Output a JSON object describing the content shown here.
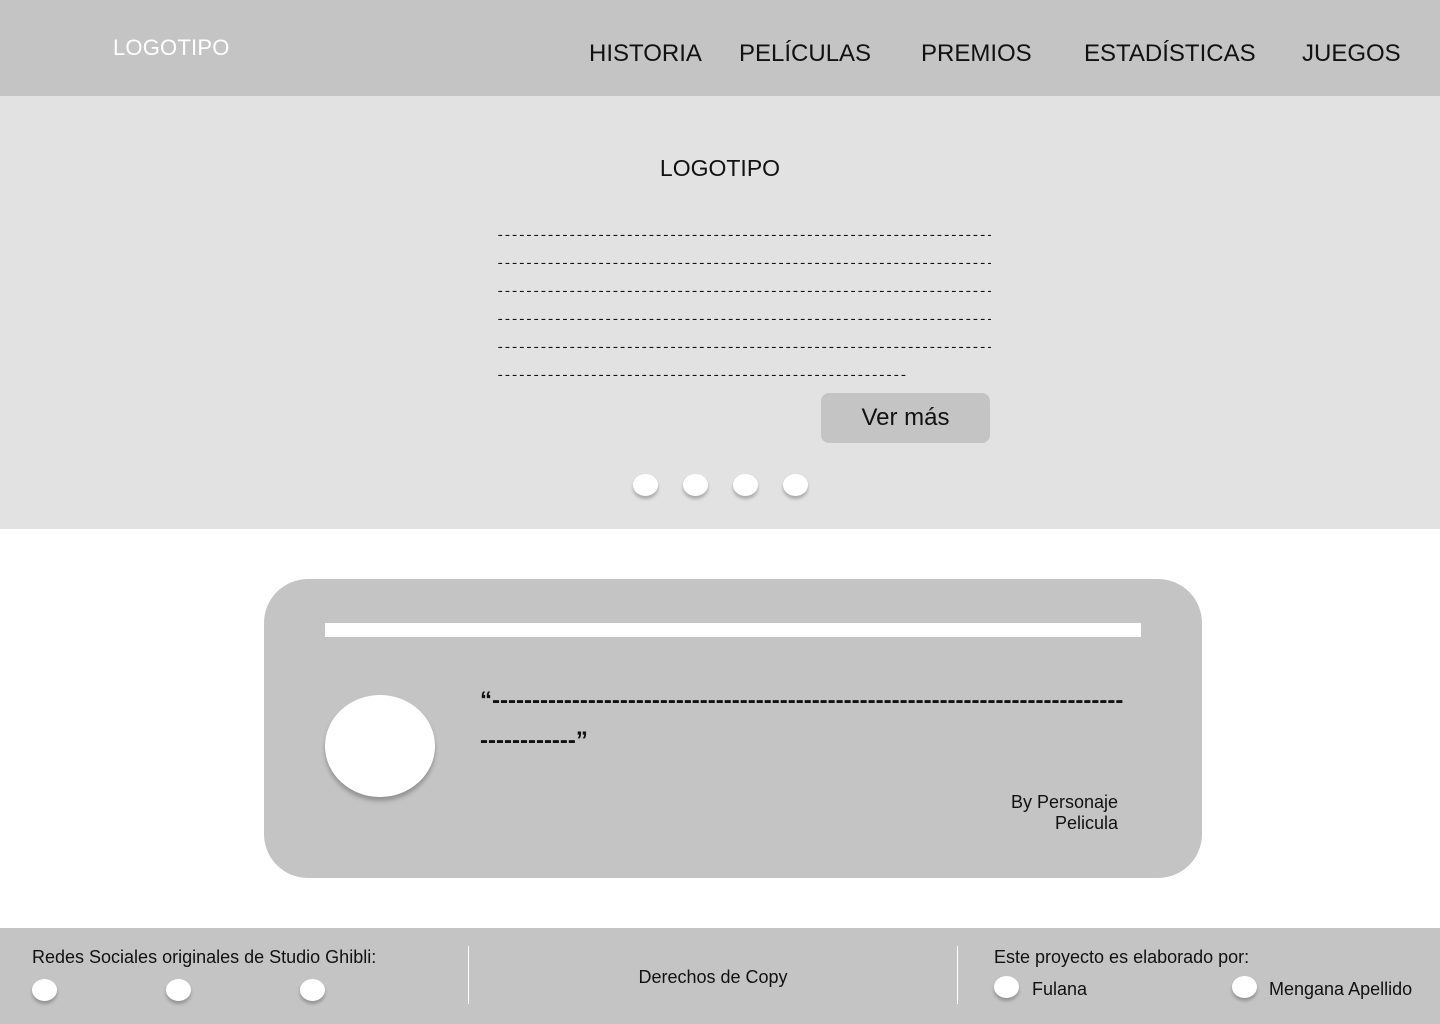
{
  "header": {
    "logo": "LOGOTIPO",
    "nav": [
      "HISTORIA",
      "PELÍCULAS",
      "PREMIOS",
      "ESTADÍSTICAS",
      "JUEGOS"
    ]
  },
  "hero": {
    "logo": "LOGOTIPO",
    "text_lines": [
      "------------------------------------------------------------------------------------------",
      "------------------------------------------------------------------------------------------",
      "------------------------------------------------------------------------------------------",
      "------------------------------------------------------------------------------------------",
      "------------------------------------------------------------------------------------------",
      "---------------------------------------------------------"
    ],
    "button_label": "Ver más",
    "carousel_dot_count": 4
  },
  "testimonial": {
    "quote": "“-------------------------------------------------------------------------------------------”",
    "author": "By Personaje",
    "source": "Pelicula"
  },
  "footer": {
    "social_title": "Redes Sociales originales de Studio Ghibli:",
    "copyright": "Derechos de Copy",
    "credits_title": "Este proyecto es elaborado por:",
    "authors": [
      "Fulana",
      "Mengana Apellido"
    ]
  }
}
